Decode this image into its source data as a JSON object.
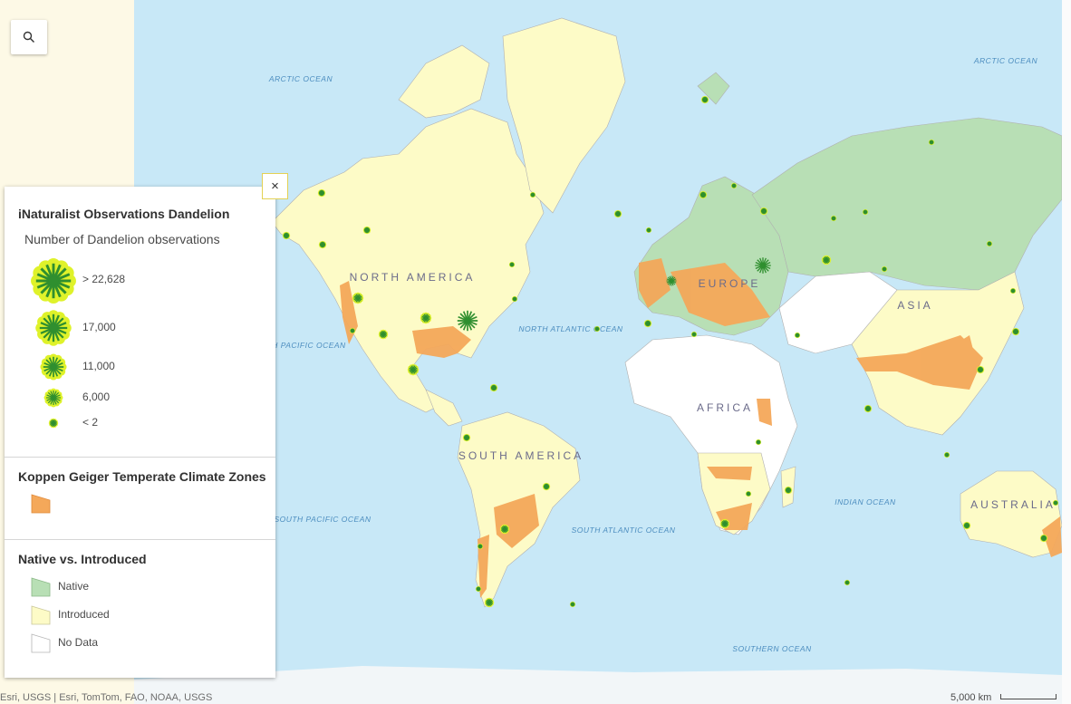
{
  "legend": {
    "obs_title": "iNaturalist Observations Dandelion",
    "obs_subtitle": "Number of Dandelion observations",
    "obs_classes": [
      ">  22,628",
      "17,000",
      "11,000",
      "6,000",
      "< 2"
    ],
    "koppen_title": "Koppen Geiger Temperate Climate Zones",
    "native_title": "Native vs. Introduced",
    "native_items": [
      "Native",
      "Introduced",
      "No Data"
    ]
  },
  "colors": {
    "ocean": "#c8e8f7",
    "native": "#b8dfb5",
    "introduced": "#fdfbc7",
    "nodata": "#ffffff",
    "temperate": "#f4a85a",
    "marker_fill": "#dff22a",
    "marker_star": "#2f8f2f"
  },
  "labels": {
    "arctic_ocean_west": "ARCTIC OCEAN",
    "arctic_ocean_east": "ARCTIC OCEAN",
    "north_pacific": "NORTH PACIFIC OCEAN",
    "north_atlantic": "NORTH ATLANTIC OCEAN",
    "south_pacific": "SOUTH PACIFIC OCEAN",
    "south_atlantic": "SOUTH ATLANTIC OCEAN",
    "indian_ocean": "INDIAN OCEAN",
    "southern_ocean": "SOUTHERN OCEAN",
    "north_america": "NORTH AMERICA",
    "south_america": "SOUTH AMERICA",
    "europe": "EUROPE",
    "asia": "ASIA",
    "africa": "AFRICA",
    "australia": "AUSTRALIA"
  },
  "attribution": "Esri, USGS | Esri, TomTom, FAO, NOAA, USGS",
  "scale": "5,000 km",
  "icons": {
    "search": "search-icon",
    "close": "close-icon"
  }
}
